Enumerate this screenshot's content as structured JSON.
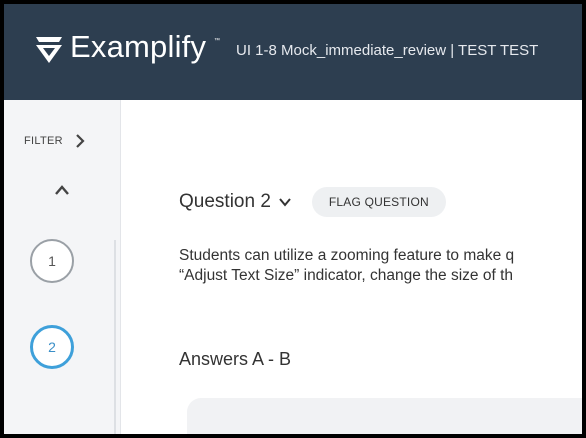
{
  "header": {
    "brand": "Examplify",
    "trademark": "™",
    "exam_title": "UI 1-8 Mock_immediate_review | TEST TEST"
  },
  "sidebar": {
    "filter_label": "FILTER",
    "questions": [
      {
        "number": "1",
        "state": "default"
      },
      {
        "number": "2",
        "state": "current"
      }
    ]
  },
  "main": {
    "question_label": "Question 2",
    "flag_label": "FLAG QUESTION",
    "body_lines": [
      "Students can utilize a zooming feature to make q",
      "“Adjust Text Size” indicator, change the size of th"
    ],
    "answers_title": "Answers A - B"
  },
  "colors": {
    "header_bg": "#2d3e50",
    "current_question": "#3ea0da"
  }
}
